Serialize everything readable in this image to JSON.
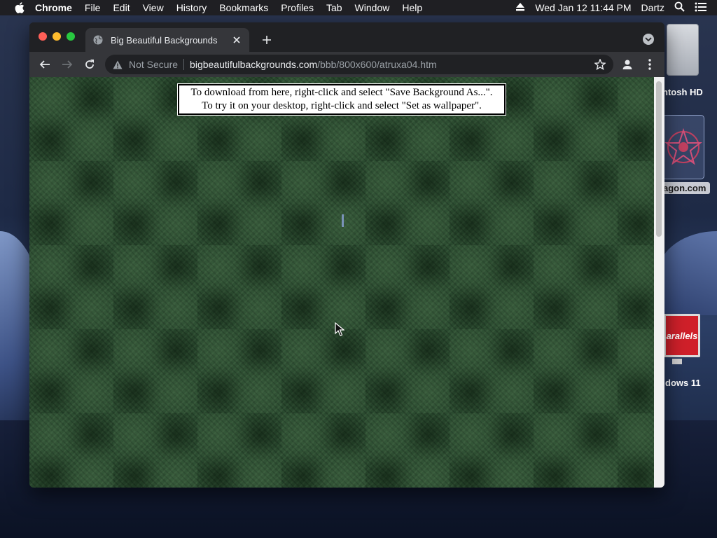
{
  "menubar": {
    "app_name": "Chrome",
    "items": [
      "File",
      "Edit",
      "View",
      "History",
      "Bookmarks",
      "Profiles",
      "Tab",
      "Window",
      "Help"
    ],
    "datetime": "Wed Jan 12  11:44 PM",
    "user": "Dartz"
  },
  "desktop": {
    "hd_label": "ntosh HD",
    "star_label": "agon.com",
    "parallels_text": "arallels",
    "win_label": "dows 11"
  },
  "browser": {
    "tab_title": "Big Beautiful Backgrounds",
    "security_label": "Not Secure",
    "url_host": "bigbeautifulbackgrounds.com",
    "url_path": "/bbb/800x600/atruxa04.htm"
  },
  "page": {
    "notice_line1": "To download from here, right-click and select \"Save Background As...\".",
    "notice_line2": "To try it on your desktop, right-click and select \"Set as wallpaper\"."
  },
  "colors": {
    "page_background": "#2a4a2f",
    "chrome_dark": "#202124",
    "toolbar": "#35363a"
  }
}
